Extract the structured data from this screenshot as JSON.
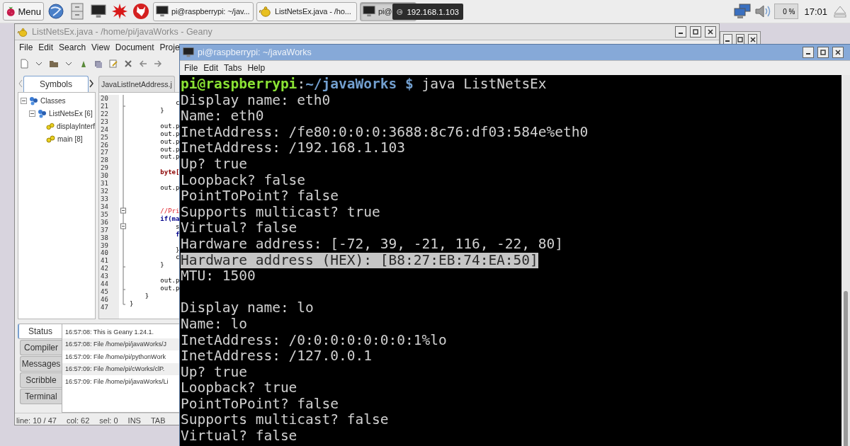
{
  "taskbar": {
    "menu_label": "Menu",
    "tasks": [
      {
        "label": "pi@raspberrypi: ~/jav...",
        "kind": "terminal",
        "selected": false
      },
      {
        "label": "ListNetsEx.java - /ho...",
        "kind": "editor",
        "selected": false
      },
      {
        "label": "pi@",
        "kind": "terminal",
        "selected": true
      }
    ],
    "tooltip": "192.168.1.103",
    "volume": "0 %",
    "clock": "17:01"
  },
  "geany": {
    "title": "ListNetsEx.java - /home/pi/javaWorks - Geany",
    "menu": [
      "File",
      "Edit",
      "Search",
      "View",
      "Document",
      "Proje"
    ],
    "sidebar_tab": {
      "label": "Symbols",
      "selected": true
    },
    "doc_tab": {
      "label": "JavaListInetAddress.j",
      "selected": false
    },
    "tree": [
      {
        "label": "Classes",
        "kind": "group",
        "expanded": true,
        "children": [
          {
            "label": "ListNetsEx [6]",
            "kind": "group",
            "expanded": true,
            "children": [
              {
                "label": "displayInterf",
                "kind": "method"
              },
              {
                "label": "main [8]",
                "kind": "method"
              }
            ]
          }
        ]
      }
    ],
    "code_lines": [
      {
        "number": "20",
        "code": "            c",
        "kind": "plain"
      },
      {
        "number": "21",
        "code": "        }",
        "kind": "plain"
      },
      {
        "number": "22"
      },
      {
        "number": "23",
        "code": "        out.p",
        "kind": "plain"
      },
      {
        "number": "24",
        "code": "        out.p",
        "kind": "plain"
      },
      {
        "number": "25",
        "code": "        out.p",
        "kind": "plain"
      },
      {
        "number": "26",
        "code": "        out.p",
        "kind": "plain"
      },
      {
        "number": "27",
        "code": "        out.p",
        "kind": "plain"
      },
      {
        "number": "28"
      },
      {
        "number": "29",
        "code": "        byte[",
        "kind": "type"
      },
      {
        "number": "30"
      },
      {
        "number": "31",
        "code": "        out.p",
        "kind": "plain"
      },
      {
        "number": "32"
      },
      {
        "number": "33"
      },
      {
        "number": "34",
        "code": "        //Pri",
        "kind": "comment"
      },
      {
        "number": "35",
        "code": "        if(ma",
        "kind": "control"
      },
      {
        "number": "36",
        "code": "            s",
        "kind": "plain"
      },
      {
        "number": "37",
        "code": "            f",
        "kind": "control"
      },
      {
        "number": "38"
      },
      {
        "number": "39",
        "code": "            }",
        "kind": "plain"
      },
      {
        "number": "40",
        "code": "            c",
        "kind": "plain"
      },
      {
        "number": "41",
        "code": "        }",
        "kind": "plain"
      },
      {
        "number": "42"
      },
      {
        "number": "43",
        "code": "        out.p",
        "kind": "plain"
      },
      {
        "number": "44",
        "code": "        out.p",
        "kind": "plain"
      },
      {
        "number": "45",
        "code": "    }",
        "kind": "plain"
      },
      {
        "number": "46",
        "code": "}",
        "kind": "plain"
      },
      {
        "number": "47"
      }
    ],
    "panel_tabs": [
      {
        "label": "Status",
        "selected": true
      },
      {
        "label": "Compiler",
        "selected": false
      },
      {
        "label": "Messages",
        "selected": false
      },
      {
        "label": "Scribble",
        "selected": false
      },
      {
        "label": "Terminal",
        "selected": false
      }
    ],
    "messages": [
      "16:57:08: This is Geany 1.24.1.",
      "16:57:08: File /home/pi/javaWorks/J",
      "16:57:09: File /home/pi/pythonWork",
      "16:57:09: File /home/pi/cWorks/clP.",
      "16:57:09: File /home/pi/javaWorks/Li"
    ],
    "status": [
      "line: 10 / 47",
      "col: 62",
      "sel: 0",
      "INS",
      "TAB"
    ]
  },
  "terminal": {
    "title": "pi@raspberrypi: ~/javaWorks",
    "menu": [
      "File",
      "Edit",
      "Tabs",
      "Help"
    ],
    "lines": [
      {
        "kind": "prompt",
        "user": "pi@raspberrypi",
        "separator": ":",
        "path": "~/javaWorks $",
        "command": "java ListNetsEx",
        "selected": false
      },
      {
        "kind": "output",
        "text": "Display name: eth0",
        "selected": false
      },
      {
        "kind": "output",
        "text": "Name: eth0",
        "selected": false
      },
      {
        "kind": "output",
        "text": "InetAddress: /fe80:0:0:0:3688:8c76:df03:584e%eth0",
        "selected": false
      },
      {
        "kind": "output",
        "text": "InetAddress: /192.168.1.103",
        "selected": false
      },
      {
        "kind": "output",
        "text": "Up? true",
        "selected": false
      },
      {
        "kind": "output",
        "text": "Loopback? false",
        "selected": false
      },
      {
        "kind": "output",
        "text": "PointToPoint? false",
        "selected": false
      },
      {
        "kind": "output",
        "text": "Supports multicast? true",
        "selected": false
      },
      {
        "kind": "output",
        "text": "Virtual? false",
        "selected": false
      },
      {
        "kind": "output",
        "text": "Hardware address: [-72, 39, -21, 116, -22, 80]",
        "selected": false
      },
      {
        "kind": "output",
        "text": "Hardware address (HEX): [B8:27:EB:74:EA:50]",
        "selected": true
      },
      {
        "kind": "output",
        "text": "MTU: 1500",
        "selected": false
      },
      {
        "kind": "blank"
      },
      {
        "kind": "output",
        "text": "Display name: lo",
        "selected": false
      },
      {
        "kind": "output",
        "text": "Name: lo",
        "selected": false
      },
      {
        "kind": "output",
        "text": "InetAddress: /0:0:0:0:0:0:0:1%lo",
        "selected": false
      },
      {
        "kind": "output",
        "text": "InetAddress: /127.0.0.1",
        "selected": false
      },
      {
        "kind": "output",
        "text": "Up? true",
        "selected": false
      },
      {
        "kind": "output",
        "text": "Loopback? true",
        "selected": false
      },
      {
        "kind": "output",
        "text": "PointToPoint? false",
        "selected": false
      },
      {
        "kind": "output",
        "text": "Supports multicast? false",
        "selected": false
      },
      {
        "kind": "output",
        "text": "Virtual? false",
        "selected": false
      }
    ]
  }
}
